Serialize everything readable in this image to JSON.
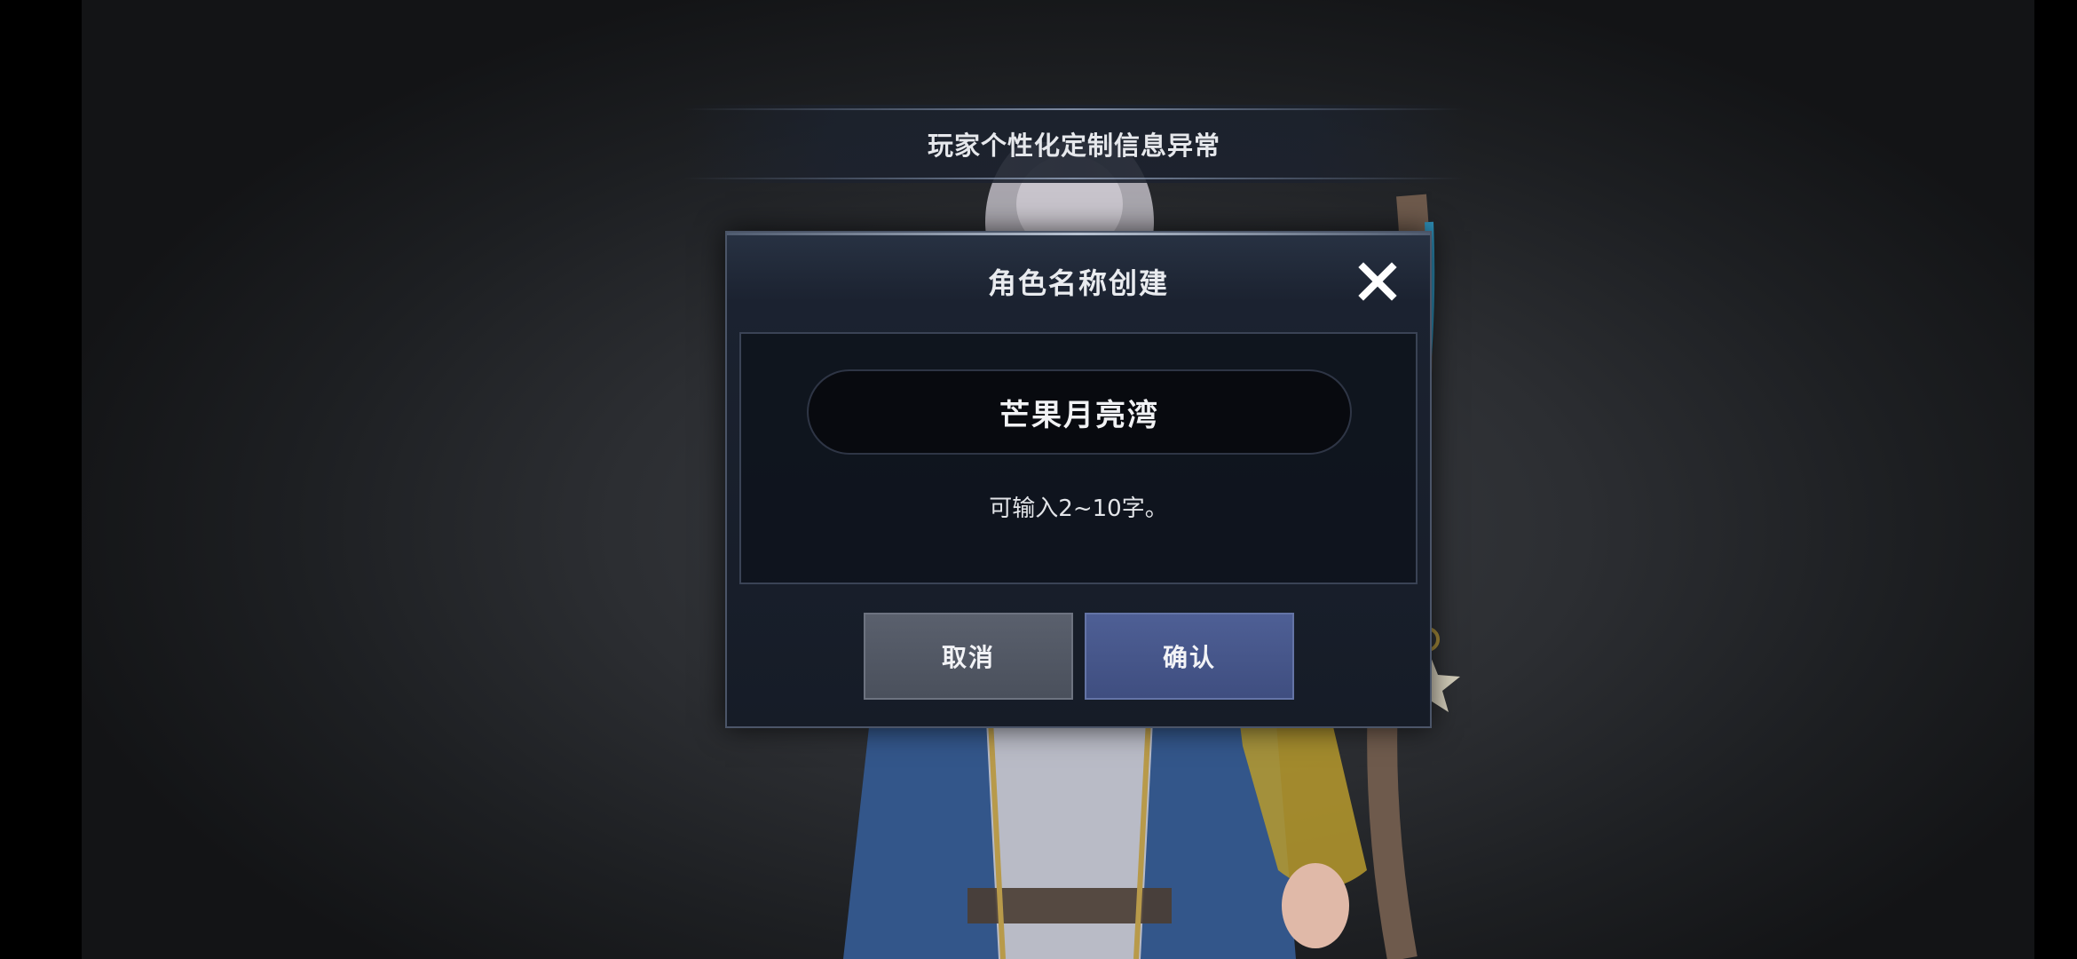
{
  "banner": {
    "text": "玩家个性化定制信息异常"
  },
  "dialog": {
    "title": "角色名称创建",
    "close_icon": "close-icon",
    "name_input": {
      "value": "芒果月亮湾"
    },
    "hint": "可输入2~10字。",
    "cancel_label": "取消",
    "confirm_label": "确认"
  },
  "colors": {
    "dialog_bg": "#161c27",
    "cancel_button": "#4a505c",
    "confirm_button": "#3f4e80"
  }
}
